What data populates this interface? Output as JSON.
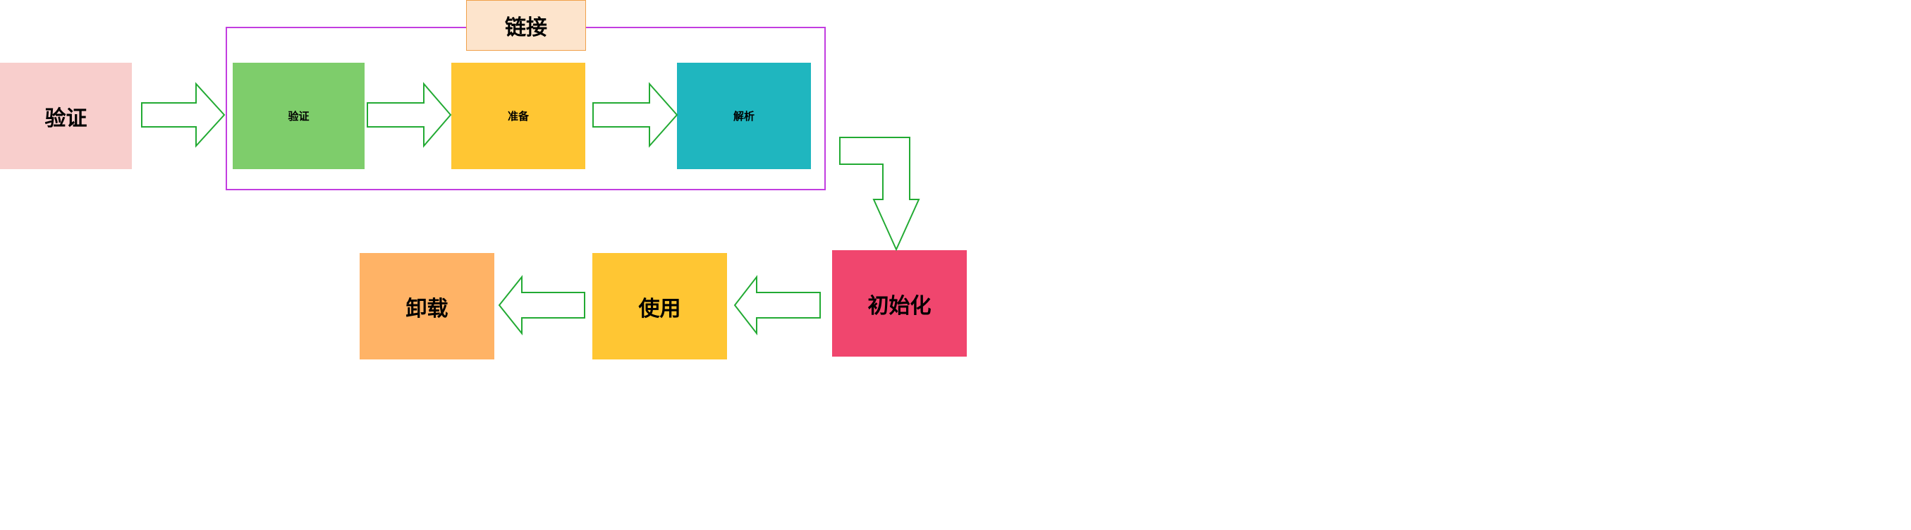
{
  "diagram": {
    "group_label": "链接",
    "nodes": {
      "verify_outer": {
        "label": "验证",
        "color": "#f8cecc"
      },
      "verify_inner": {
        "label": "验证",
        "color": "#7ecd6b"
      },
      "prepare": {
        "label": "准备",
        "color": "#ffc633"
      },
      "resolve": {
        "label": "解析",
        "color": "#1fb6bf"
      },
      "initialize": {
        "label": "初始化",
        "color": "#f0466e"
      },
      "use": {
        "label": "使用",
        "color": "#ffc633"
      },
      "unload": {
        "label": "卸载",
        "color": "#ffb366"
      }
    },
    "colors": {
      "group_border": "#c23de0",
      "group_label_fill": "#fde4cc",
      "arrow_stroke": "#22aa33"
    }
  }
}
